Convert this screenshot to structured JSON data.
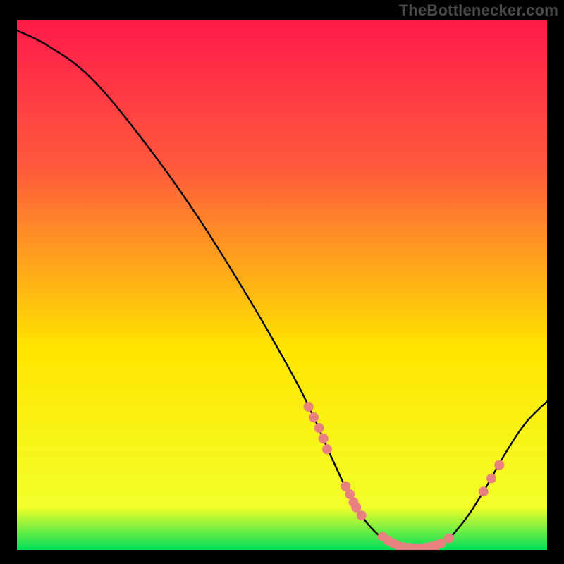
{
  "watermark": "TheBottlenecker.com",
  "colors": {
    "top": "#ff1a4b",
    "mid": "#ffe500",
    "bottom": "#00e05a",
    "curve": "#000000",
    "marker": "#e98080",
    "background": "#000000"
  },
  "chart_data": {
    "type": "line",
    "title": "",
    "xlabel": "",
    "ylabel": "",
    "xlim": [
      0,
      100
    ],
    "ylim": [
      0,
      100
    ],
    "grid": false,
    "legend": false,
    "curve_note": "Piecewise curve: starts near top-left at y≈98, descends steeply, bottoms out (y≈0) around x≈70–80, then rises toward y≈28 at x=100. No axis ticks or numeric labels are visible in the image; values are proportional estimates read from pixel geometry.",
    "curve_points": [
      {
        "x": 0,
        "y": 98
      },
      {
        "x": 6,
        "y": 95
      },
      {
        "x": 14,
        "y": 89
      },
      {
        "x": 24,
        "y": 77
      },
      {
        "x": 34,
        "y": 63
      },
      {
        "x": 44,
        "y": 47
      },
      {
        "x": 52,
        "y": 33
      },
      {
        "x": 56,
        "y": 25
      },
      {
        "x": 60,
        "y": 16
      },
      {
        "x": 64,
        "y": 8
      },
      {
        "x": 68,
        "y": 3
      },
      {
        "x": 72,
        "y": 0.5
      },
      {
        "x": 76,
        "y": 0.3
      },
      {
        "x": 80,
        "y": 1
      },
      {
        "x": 84,
        "y": 5
      },
      {
        "x": 88,
        "y": 11
      },
      {
        "x": 92,
        "y": 18
      },
      {
        "x": 96,
        "y": 24
      },
      {
        "x": 100,
        "y": 28
      }
    ],
    "marker_clusters": [
      [
        {
          "x": 55,
          "y": 27
        },
        {
          "x": 56,
          "y": 25
        },
        {
          "x": 57,
          "y": 23
        },
        {
          "x": 57.8,
          "y": 21
        },
        {
          "x": 58.5,
          "y": 19
        }
      ],
      [
        {
          "x": 62,
          "y": 12
        },
        {
          "x": 62.8,
          "y": 10.5
        },
        {
          "x": 63.5,
          "y": 9
        },
        {
          "x": 64,
          "y": 8
        },
        {
          "x": 65,
          "y": 6.5
        }
      ],
      [
        {
          "x": 69,
          "y": 2.5
        },
        {
          "x": 70,
          "y": 1.8
        },
        {
          "x": 71,
          "y": 1.2
        },
        {
          "x": 72,
          "y": 0.7
        },
        {
          "x": 73,
          "y": 0.5
        },
        {
          "x": 74,
          "y": 0.4
        },
        {
          "x": 75,
          "y": 0.3
        },
        {
          "x": 76,
          "y": 0.3
        },
        {
          "x": 77,
          "y": 0.4
        },
        {
          "x": 78,
          "y": 0.6
        },
        {
          "x": 79,
          "y": 0.8
        },
        {
          "x": 80,
          "y": 1.2
        },
        {
          "x": 81.5,
          "y": 2.2
        }
      ],
      [
        {
          "x": 88,
          "y": 11
        },
        {
          "x": 89.5,
          "y": 13.5
        },
        {
          "x": 91,
          "y": 16
        }
      ]
    ]
  }
}
